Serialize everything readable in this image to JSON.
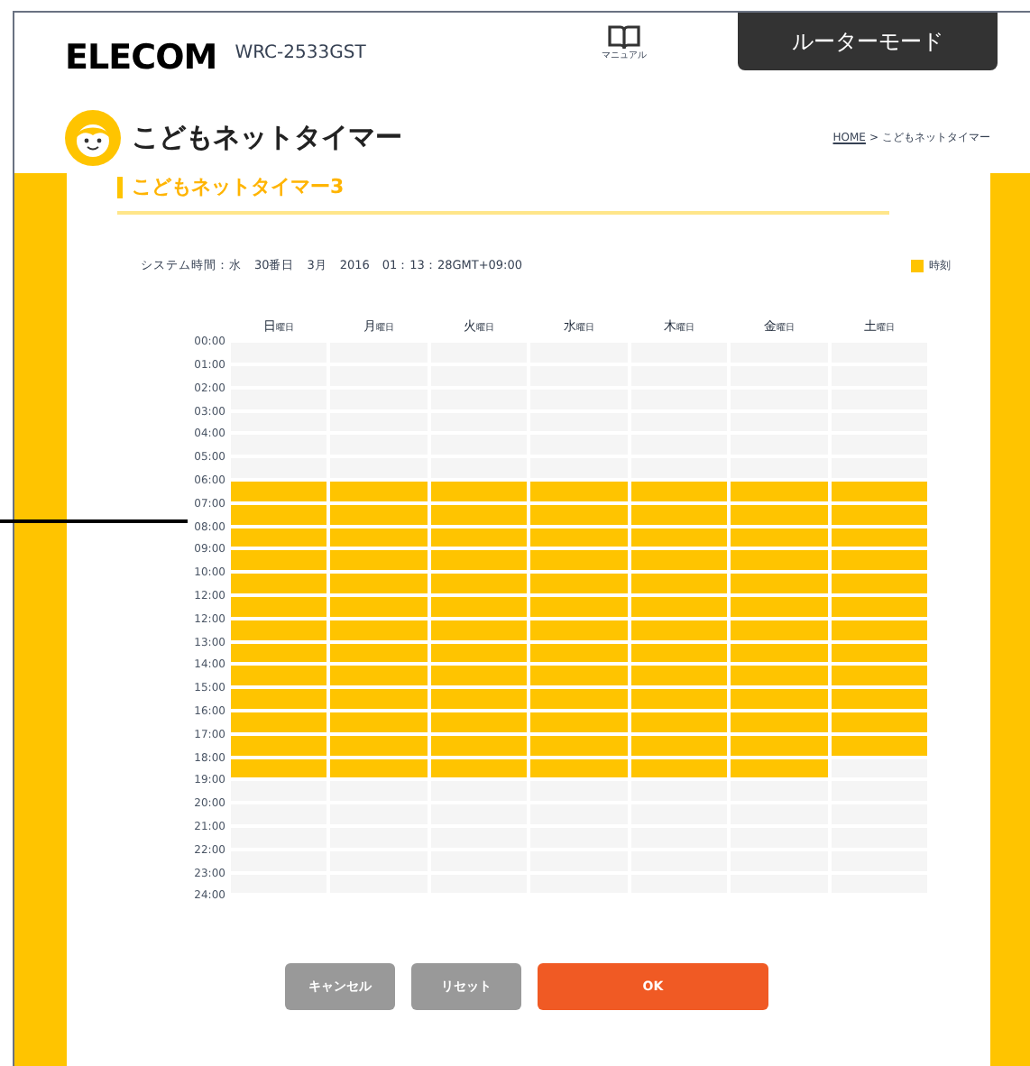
{
  "header": {
    "logo": "ELECOM",
    "model": "WRC-2533GST",
    "manual": "マニュアル",
    "mode": "ルーターモード"
  },
  "page_title": "こどもネットタイマー",
  "breadcrumb": {
    "home": "HOME",
    "separator": ">",
    "current": "こどもネットタイマー"
  },
  "section_title": "こどもネットタイマー3",
  "system_time": "システム時間：水　30番日　3月　2016　01：13：28GMT+09:00",
  "legend": "時刻",
  "days": [
    {
      "day": "日",
      "suffix": "曜日"
    },
    {
      "day": "月",
      "suffix": "曜日"
    },
    {
      "day": "火",
      "suffix": "曜日"
    },
    {
      "day": "水",
      "suffix": "曜日"
    },
    {
      "day": "木",
      "suffix": "曜日"
    },
    {
      "day": "金",
      "suffix": "曜日"
    },
    {
      "day": "土",
      "suffix": "曜日"
    }
  ],
  "hour_labels": [
    "00:00",
    "01:00",
    "02:00",
    "03:00",
    "04:00",
    "05:00",
    "06:00",
    "07:00",
    "08:00",
    "09:00",
    "10:00",
    "12:00",
    "12:00",
    "13:00",
    "14:00",
    "15:00",
    "16:00",
    "17:00",
    "18:00",
    "19:00",
    "20:00",
    "21:00",
    "22:00",
    "23:00",
    "24:00"
  ],
  "schedule": [
    [
      false,
      false,
      false,
      false,
      false,
      false,
      false
    ],
    [
      false,
      false,
      false,
      false,
      false,
      false,
      false
    ],
    [
      false,
      false,
      false,
      false,
      false,
      false,
      false
    ],
    [
      false,
      false,
      false,
      false,
      false,
      false,
      false
    ],
    [
      false,
      false,
      false,
      false,
      false,
      false,
      false
    ],
    [
      false,
      false,
      false,
      false,
      false,
      false,
      false
    ],
    [
      true,
      true,
      true,
      true,
      true,
      true,
      true
    ],
    [
      true,
      true,
      true,
      true,
      true,
      true,
      true
    ],
    [
      true,
      true,
      true,
      true,
      true,
      true,
      true
    ],
    [
      true,
      true,
      true,
      true,
      true,
      true,
      true
    ],
    [
      true,
      true,
      true,
      true,
      true,
      true,
      true
    ],
    [
      true,
      true,
      true,
      true,
      true,
      true,
      true
    ],
    [
      true,
      true,
      true,
      true,
      true,
      true,
      true
    ],
    [
      true,
      true,
      true,
      true,
      true,
      true,
      true
    ],
    [
      true,
      true,
      true,
      true,
      true,
      true,
      true
    ],
    [
      true,
      true,
      true,
      true,
      true,
      true,
      true
    ],
    [
      true,
      true,
      true,
      true,
      true,
      true,
      true
    ],
    [
      true,
      true,
      true,
      true,
      true,
      true,
      true
    ],
    [
      true,
      true,
      true,
      true,
      true,
      true,
      false
    ],
    [
      false,
      false,
      false,
      false,
      false,
      false,
      false
    ],
    [
      false,
      false,
      false,
      false,
      false,
      false,
      false
    ],
    [
      false,
      false,
      false,
      false,
      false,
      false,
      false
    ],
    [
      false,
      false,
      false,
      false,
      false,
      false,
      false
    ],
    [
      false,
      false,
      false,
      false,
      false,
      false,
      false
    ]
  ],
  "buttons": [
    {
      "label": "キャンセル",
      "kind": "secondary"
    },
    {
      "label": "リセット",
      "kind": "secondary"
    },
    {
      "label": "OK",
      "kind": "primary"
    }
  ]
}
